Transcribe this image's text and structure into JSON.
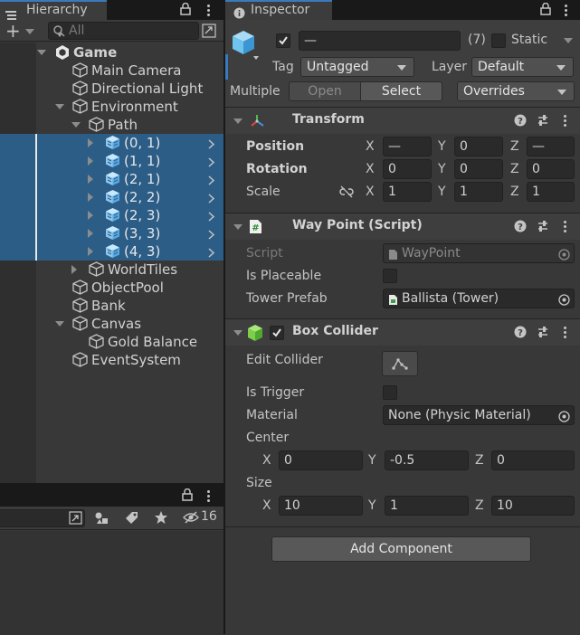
{
  "hierarchy": {
    "tab_label": "Hierarchy",
    "add_label": "+",
    "search_placeholder": "All",
    "items": [
      {
        "label": "Game",
        "bold": true
      },
      {
        "label": "Main Camera"
      },
      {
        "label": "Directional Light"
      },
      {
        "label": "Environment"
      },
      {
        "label": "Path"
      },
      {
        "label": "(0, 1)",
        "selected": true
      },
      {
        "label": "(1, 1)",
        "selected": true
      },
      {
        "label": "(2, 1)",
        "selected": true
      },
      {
        "label": "(2, 2)",
        "selected": true
      },
      {
        "label": "(2, 3)",
        "selected": true
      },
      {
        "label": "(3, 3)",
        "selected": true
      },
      {
        "label": "(4, 3)",
        "selected": true
      },
      {
        "label": "WorldTiles"
      },
      {
        "label": "ObjectPool"
      },
      {
        "label": "Bank"
      },
      {
        "label": "Canvas"
      },
      {
        "label": "Gold Balance"
      },
      {
        "label": "EventSystem"
      }
    ]
  },
  "project": {
    "hidden_count": "16"
  },
  "inspector": {
    "tab_label": "Inspector",
    "name_value": "—",
    "count_label": "(7)",
    "static_label": "Static",
    "tag_label": "Tag",
    "tag_value": "Untagged",
    "layer_label": "Layer",
    "layer_value": "Default",
    "multiple_label": "Multiple",
    "open_label": "Open",
    "select_label": "Select",
    "overrides_label": "Overrides",
    "transform": {
      "title": "Transform",
      "position_label": "Position",
      "rotation_label": "Rotation",
      "scale_label": "Scale",
      "x": "X",
      "y": "Y",
      "z": "Z",
      "position": [
        "—",
        "0",
        "—"
      ],
      "rotation": [
        "0",
        "0",
        "0"
      ],
      "scale": [
        "1",
        "1",
        "1"
      ]
    },
    "waypoint": {
      "title": "Way Point (Script)",
      "script_label": "Script",
      "script_value": "WayPoint",
      "placeable_label": "Is Placeable",
      "prefab_label": "Tower Prefab",
      "prefab_value": "Ballista (Tower)"
    },
    "box_collider": {
      "title": "Box Collider",
      "edit_label": "Edit Collider",
      "trigger_label": "Is Trigger",
      "material_label": "Material",
      "material_value": "None (Physic Material)",
      "center_label": "Center",
      "center": [
        "0",
        "-0.5",
        "0"
      ],
      "size_label": "Size",
      "size": [
        "10",
        "1",
        "10"
      ]
    },
    "add_component_label": "Add Component"
  }
}
